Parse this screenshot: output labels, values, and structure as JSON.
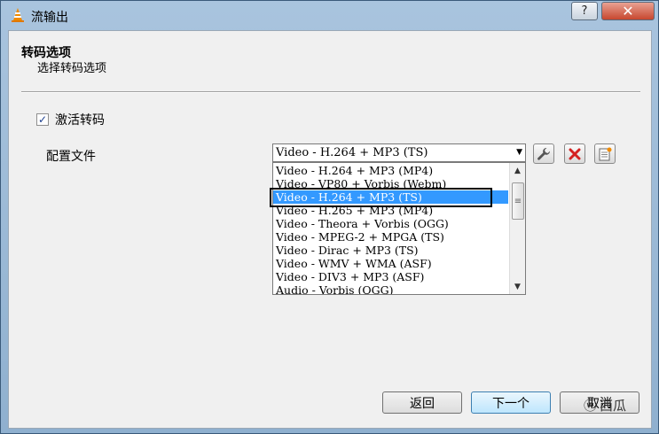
{
  "window": {
    "title": "流输出",
    "help_label": "?",
    "close_label": "✕"
  },
  "header": {
    "title": "转码选项",
    "subtitle": "选择转码选项"
  },
  "transcode": {
    "checkbox_label": "激活转码",
    "checked": true,
    "check_glyph": "✓"
  },
  "profile": {
    "label": "配置文件",
    "selected": "Video - H.264 + MP3 (TS)",
    "options": [
      "Video - H.264 + MP3 (MP4)",
      "Video - VP80 + Vorbis (Webm)",
      "Video - H.264 + MP3 (TS)",
      "Video - H.265 + MP3 (MP4)",
      "Video - Theora + Vorbis (OGG)",
      "Video - MPEG-2 + MPGA (TS)",
      "Video - Dirac + MP3 (TS)",
      "Video - WMV + WMA (ASF)",
      "Video - DIV3 + MP3 (ASF)",
      "Audio - Vorbis (OGG)"
    ],
    "highlighted_index": 2,
    "tools": [
      "wrench-icon",
      "delete-x-icon",
      "new-profile-icon"
    ]
  },
  "footer": {
    "back_label": "返回",
    "next_label": "下一个",
    "cancel_label": "取消",
    "watermark_text": "西瓜"
  },
  "colors": {
    "selection": "#3399ff",
    "delete_red": "#d42020",
    "vlc_orange": "#f08a00"
  }
}
